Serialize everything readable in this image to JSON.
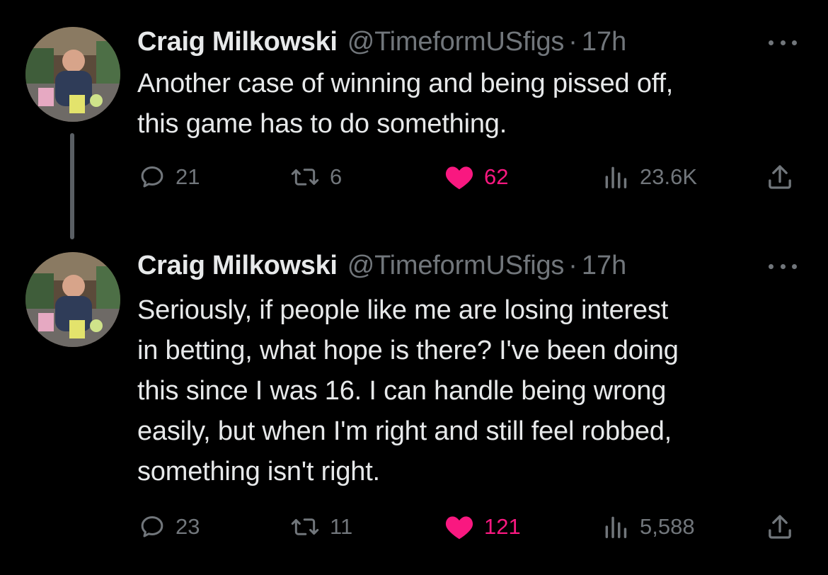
{
  "colors": {
    "background": "#000000",
    "text_primary": "#e7e9ea",
    "text_secondary": "#71767b",
    "like_pink": "#f91880",
    "thread_line": "#5a5f64"
  },
  "tweets": [
    {
      "author_name": "Craig Milkowski",
      "handle": "@TimeformUSfigs",
      "separator": "·",
      "time": "17h",
      "text_lines": [
        "Another case of winning and being pissed off,",
        "this game has to do something."
      ],
      "replies": "21",
      "retweets": "6",
      "likes": "62",
      "views": "23.6K",
      "liked": true
    },
    {
      "author_name": "Craig Milkowski",
      "handle": "@TimeformUSfigs",
      "separator": "·",
      "time": "17h",
      "text_lines": [
        "Seriously, if people like me are losing interest",
        "in betting, what hope is there? I've been doing",
        "this since I was 16. I can handle being wrong",
        "easily, but when I'm right and still feel robbed,",
        "something isn't right."
      ],
      "replies": "23",
      "retweets": "11",
      "likes": "121",
      "views": "5,588",
      "liked": true
    }
  ],
  "icons": {
    "reply": "reply-bubble-icon",
    "retweet": "retweet-arrows-icon",
    "like": "heart-filled-icon",
    "views": "bar-chart-icon",
    "share": "share-upload-icon",
    "more": "ellipsis-icon"
  }
}
